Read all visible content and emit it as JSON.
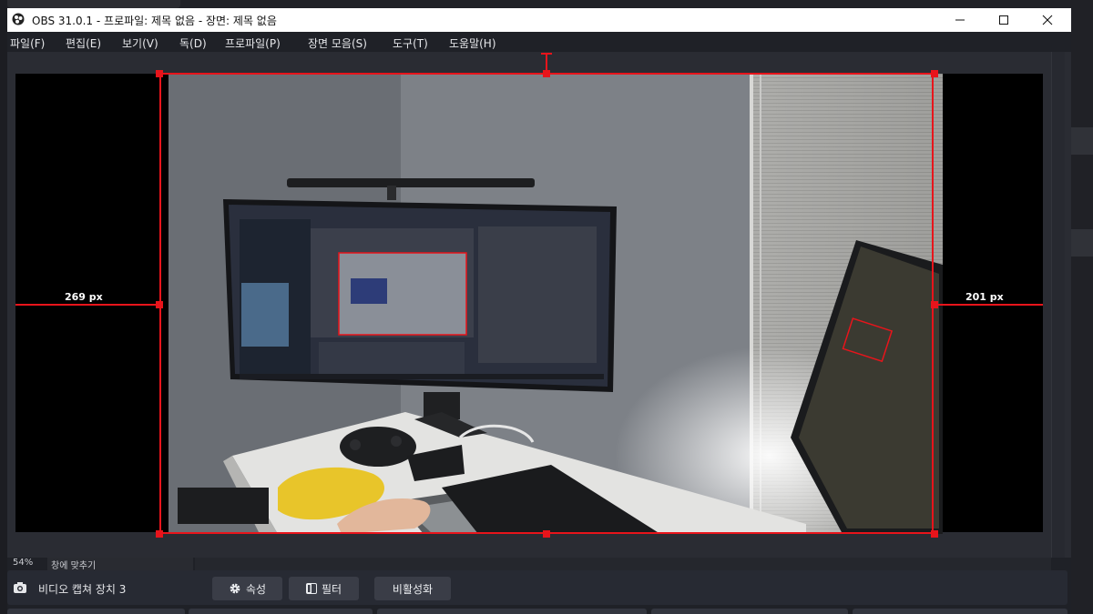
{
  "window": {
    "title": "OBS 31.0.1 - 프로파일: 제목 없음 - 장면: 제목 없음",
    "controls": {
      "minimize": "minimize",
      "maximize": "maximize",
      "close": "close"
    }
  },
  "menu": [
    "파일(F)",
    "편집(E)",
    "보기(V)",
    "독(D)",
    "프로파일(P)",
    "장면 모음(S)",
    "도구(T)",
    "도움말(H)"
  ],
  "preview": {
    "guide_left_label": "269 px",
    "guide_right_label": "201 px",
    "zoom": "54%",
    "zoom_mode": "창에 맞추기"
  },
  "source": {
    "name": "비디오 캡쳐 장치 3",
    "properties_label": "속성",
    "filters_label": "필터",
    "disable_label": "비활성화"
  },
  "colors": {
    "accent": "#e8141b",
    "window_bg": "#1f2127",
    "button_bg": "#3a3d47"
  },
  "icons": {
    "app": "obs-logo-icon",
    "camera": "camera-icon",
    "properties": "gear-icon",
    "filters": "filter-icon",
    "zoom_dropdown": "caret-down-icon"
  }
}
